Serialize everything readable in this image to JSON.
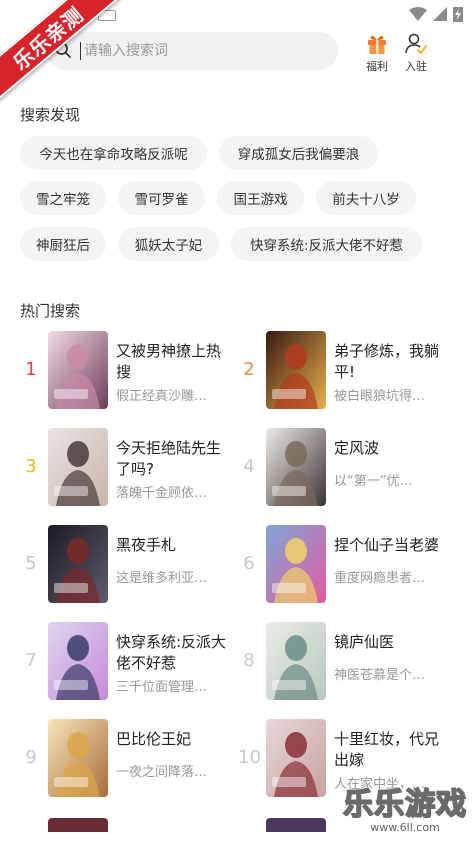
{
  "badge": {
    "ribbon_text": "乐乐亲测"
  },
  "search": {
    "placeholder": "请输入搜索词"
  },
  "header": {
    "welfare_label": "福利",
    "join_label": "入驻"
  },
  "discover": {
    "title": "搜索发现",
    "tags": [
      "今天也在拿命攻略反派呢",
      "穿成孤女后我偏要浪",
      "雪之牢笼",
      "雪可罗雀",
      "国王游戏",
      "前夫十八岁",
      "神厨狂后",
      "狐妖太子妃",
      "快穿系统:反派大佬不好惹"
    ]
  },
  "hot": {
    "title": "热门搜索",
    "items": [
      {
        "rank": "1",
        "title": "又被男神撩上热搜",
        "desc": "假正经真沙雕…",
        "cover": [
          "#f3d9e6",
          "#c98aa6",
          "#6b3f56"
        ]
      },
      {
        "rank": "2",
        "title": "弟子修炼，我躺平!",
        "desc": "被白眼狼坑得…",
        "cover": [
          "#3a1a14",
          "#b33a1e",
          "#e8b04a"
        ]
      },
      {
        "rank": "3",
        "title": "今天拒绝陆先生了吗?",
        "desc": "落魄千金顾依…",
        "cover": [
          "#e9e4e4",
          "#4a3a3a",
          "#c7b6a8"
        ]
      },
      {
        "rank": "4",
        "title": "定风波",
        "desc": "以“第一”优…",
        "cover": [
          "#eceae6",
          "#7a6a5c",
          "#3a3434"
        ]
      },
      {
        "rank": "5",
        "title": "黑夜手札",
        "desc": "这是维多利亚…",
        "cover": [
          "#1e1a22",
          "#7b2a28",
          "#5d5a6e"
        ]
      },
      {
        "rank": "6",
        "title": "捏个仙子当老婆",
        "desc": "重度网瘾患者…",
        "cover": [
          "#7ea6d6",
          "#f1d06a",
          "#e45aa0"
        ]
      },
      {
        "rank": "7",
        "title": "快穿系统:反派大佬不好惹",
        "desc": "三千位面管理…",
        "cover": [
          "#ddd6ef",
          "#3a3a66",
          "#c68ad8"
        ]
      },
      {
        "rank": "8",
        "title": "镜庐仙医",
        "desc": "神医苍慕是个…",
        "cover": [
          "#e8eee6",
          "#6c8c86",
          "#b9c7bd"
        ]
      },
      {
        "rank": "9",
        "title": "巴比伦王妃",
        "desc": "一夜之间降落…",
        "cover": [
          "#f7e7b9",
          "#dba64a",
          "#a86a3a"
        ]
      },
      {
        "rank": "10",
        "title": "十里红妆，代兄出嫁",
        "desc": "人在家中坐，…",
        "cover": [
          "#e6d8d8",
          "#8a2f36",
          "#c9a1a1"
        ]
      }
    ]
  },
  "watermark": {
    "brand": "乐乐游戏",
    "site": "www.6ll.com"
  }
}
